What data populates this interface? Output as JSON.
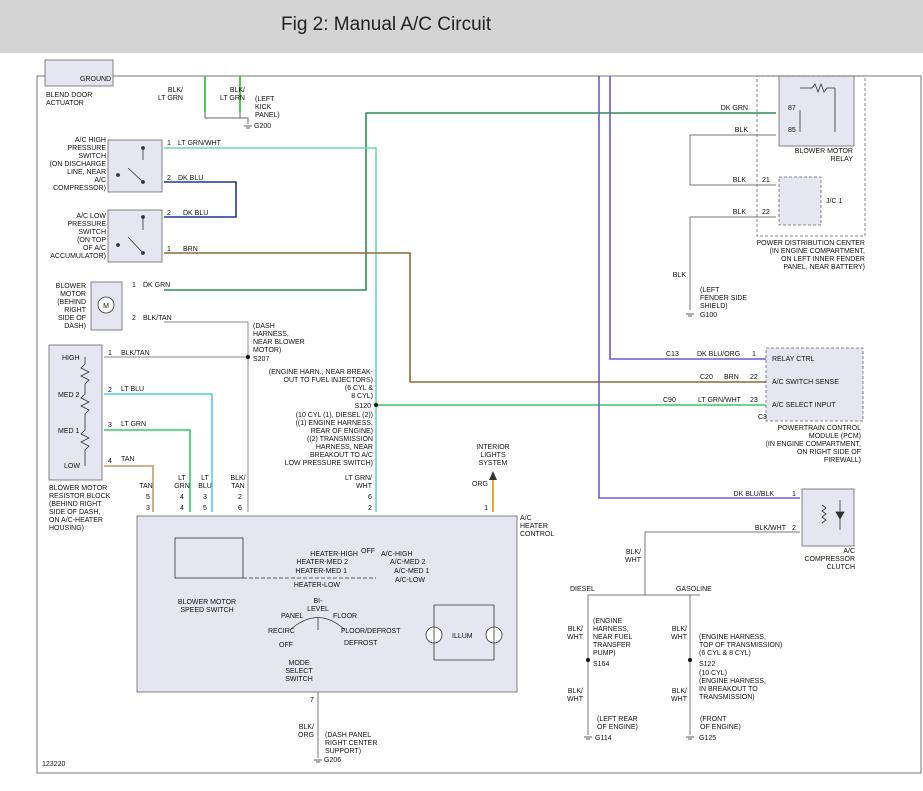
{
  "title": "Fig 2: Manual A/C Circuit",
  "diagram_id": "123220",
  "colors": {
    "title_bar": "#d4d4d4",
    "wire_dk_grn": "#2e8b57",
    "wire_lt_grn": "#33cc66",
    "wire_lt_grn_wht": "#66ddaa",
    "wire_dk_blu": "#1f3a93",
    "wire_brn": "#8b6a33",
    "wire_tan": "#c49a6c",
    "wire_lt_blu": "#55ccee",
    "wire_purple": "#6a5acd",
    "wire_org": "#f08a00",
    "wire_gray": "#888888"
  },
  "top_left": {
    "blend_door": "BLEND DOOR\nACTUATOR",
    "ground_label": "GROUND",
    "blk_lt_grn_1": "BLK/\nLT GRN",
    "blk_lt_grn_2": "BLK/\nLT GRN",
    "left_kick_panel": "(LEFT\nKICK\nPANEL)",
    "g200": "G200"
  },
  "high_pressure_switch": {
    "label": "A/C HIGH\nPRESSURE\nSWITCH\n(ON DISCHARGE\nLINE, NEAR\nA/C\nCOMPRESSOR)",
    "pin1": "1",
    "pin1_wire": "LT GRN/WHT",
    "pin2": "2",
    "pin2_wire": "DK BLU"
  },
  "low_pressure_switch": {
    "label": "A/C LOW\nPRESSURE\nSWITCH\n(ON TOP\nOF A/C\nACCUMULATOR)",
    "pin2": "2",
    "pin2_wire": "DK BLU",
    "pin1": "1",
    "pin1_wire": "BRN"
  },
  "blower_motor": {
    "label": "BLOWER\nMOTOR\n(BEHIND\nRIGHT\nSIDE OF\nDASH)",
    "symbol": "M",
    "pin1": "1",
    "pin1_wire": "DK GRN",
    "pin2": "2",
    "pin2_wire": "BLK/TAN"
  },
  "dash_harness": {
    "label": "(DASH\nHARNESS,\nNEAR BLOWER\nMOTOR)",
    "splice": "S207"
  },
  "resistor_block": {
    "label": "BLOWER MOTOR\nRESISTOR BLOCK\n(BEHIND RIGHT\nSIDE OF DASH,\nON A/C-HEATER\nHOUSING)",
    "high": "HIGH",
    "med2": "MED 2",
    "med1": "MED 1",
    "low": "LOW",
    "pin1": "1",
    "pin1_wire": "BLK/TAN",
    "pin2": "2",
    "pin2_wire": "LT BLU",
    "pin3": "3",
    "pin3_wire": "LT GRN",
    "pin4": "4",
    "pin4_wire": "TAN"
  },
  "engine_harness": {
    "label_top": "(ENGINE HARN., NEAR BREAK-\nOUT TO FUEL INJECTORS)\n(6 CYL &\n8 CYL)",
    "splice": "S120",
    "label_bottom": "(10 CYL (1), DIESEL (2))\n((1) ENGINE HARNESS,\nREAR OF ENGINE)\n((2) TRANSMISSION\nHARNESS, NEAR\nBREAKOUT TO A/C\nLOW PRESSURE SWITCH)"
  },
  "control_connector": {
    "col1_wire": "TAN",
    "col1_pin_a": "5",
    "col1_pin_b": "3",
    "col2_wire": "LT\nGRN",
    "col2_pin_a": "4",
    "col2_pin_b": "4",
    "col3_wire": "LT\nBLU",
    "col3_pin_a": "3",
    "col3_pin_b": "5",
    "col4_wire": "BLK/\nTAN",
    "col4_pin_a": "2",
    "col4_pin_b": "6",
    "col5_wire": "LT GRN/\nWHT",
    "col5_pin_a": "6",
    "col5_pin_b": "2",
    "col6_wire": "ORG",
    "col6_pin": "1",
    "interior_lights": "INTERIOR\nLIGHTS\nSYSTEM"
  },
  "heater_control": {
    "label": "A/C\nHEATER\nCONTROL",
    "blower_speed_switch": "BLOWER MOTOR\nSPEED SWITCH",
    "off": "OFF",
    "heater_high": "HEATER-HIGH",
    "heater_med2": "HEATER-MED 2",
    "heater_med1": "HEATER-MED 1",
    "heater_low": "HEATER-LOW",
    "ac_high": "A/C-HIGH",
    "ac_med2": "A/C-MED 2",
    "ac_med1": "A/C-MED 1",
    "ac_low": "A/C-LOW",
    "bi_level": "BI-\nLEVEL",
    "panel": "PANEL",
    "floor": "FLOOR",
    "recirc": "RECIRC",
    "floor_defrost": "FLOOR/DEFROST",
    "off2": "OFF",
    "defrost": "DEFROST",
    "mode_select": "MODE\nSELECT\nSWITCH",
    "illum": "ILLUM",
    "pin7": "7",
    "blk_org": "BLK/\nORG",
    "dash_panel": "(DASH PANEL\nRIGHT CENTER\nSUPPORT)",
    "g206": "G206"
  },
  "blower_relay": {
    "label": "BLOWER MOTOR\nRELAY",
    "pin87": "87",
    "pin87_wire": "DK GRN",
    "pin85": "85",
    "pin85_wire": "BLK"
  },
  "pdc": {
    "jc1": "J/C 1",
    "pin21": "21",
    "pin21_wire": "BLK",
    "pin22": "22",
    "pin22_wire": "BLK",
    "label": "POWER DISTRIBUTION CENTER\n(IN ENGINE COMPARTMENT,\nON LEFT INNER FENDER\nPANEL, NEAR BATTERY)",
    "blk": "BLK",
    "fender": "(LEFT\nFENDER SIDE\nSHIELD)",
    "g100": "G100"
  },
  "pcm": {
    "relay_ctrl": "RELAY CTRL",
    "ac_switch_sense": "A/C SWITCH SENSE",
    "ac_select_input": "A/C SELECT INPUT",
    "c13": "C13",
    "c13_wire": "DK BLU/ORG",
    "c13_pin": "1",
    "c20": "C20",
    "c20_wire": "BRN",
    "c20_pin": "22",
    "c90": "C90",
    "c90_wire": "LT GRN/WHT",
    "c90_pin": "23",
    "c3": "C3",
    "label": "POWERTRAIN CONTROL\nMODULE (PCM)\n(IN ENGINE COMPARTMENT,\nON RIGHT SIDE OF\nFIREWALL)"
  },
  "compressor_clutch": {
    "label": "A/C\nCOMPRESSOR\nCLUTCH",
    "pin1": "1",
    "pin1_wire": "DK BLU/BLK",
    "pin2": "2",
    "pin2_wire": "BLK/WHT"
  },
  "grounds": {
    "blk_wht": "BLK/\nWHT",
    "diesel": "DIESEL",
    "gasoline": "GASOLINE",
    "diesel_blk_wht": "BLK/\nWHT",
    "diesel_harness": "(ENGINE\nHARNESS,\nNEAR FUEL\nTRANSFER\nPUMP)",
    "s164": "S164",
    "diesel_blk_wht2": "BLK/\nWHT",
    "left_rear": "(LEFT REAR\nOF ENGINE)",
    "g114": "G114",
    "gas_blk_wht": "BLK/\nWHT",
    "gas_harness": "(ENGINE HARNESS,\nTOP OF TRANSMISSION)\n(6 CYL & 8 CYL)",
    "s122": "S122",
    "gas_10cyl": "(10 CYL)\n(ENGINE HARNESS,\nIN BREAKOUT TO\nTRANSMISSION)",
    "gas_blk_wht2": "BLK/\nWHT",
    "front": "(FRONT\nOF ENGINE)",
    "g125": "G125"
  }
}
